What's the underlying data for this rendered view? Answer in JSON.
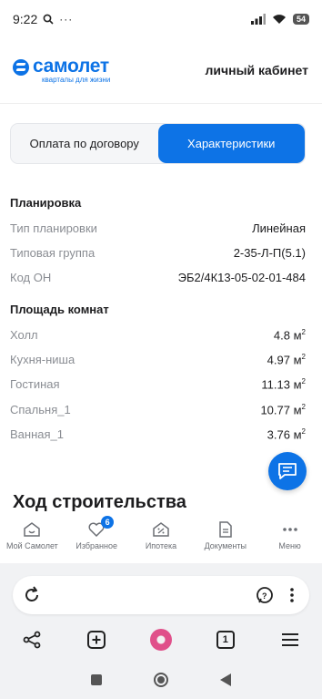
{
  "status_bar": {
    "time": "9:22",
    "battery": "54"
  },
  "header": {
    "logo_name": "самолет",
    "logo_tagline": "кварталы для жизни",
    "cabinet_link": "личный кабинет"
  },
  "tabs": [
    {
      "label": "Оплата по договору",
      "active": false
    },
    {
      "label": "Характеристики",
      "active": true
    }
  ],
  "layout_section": {
    "title": "Планировка",
    "rows": [
      {
        "label": "Тип планировки",
        "value": "Линейная"
      },
      {
        "label": "Типовая группа",
        "value": "2-35-Л-П(5.1)"
      },
      {
        "label": "Код ОН",
        "value": "ЭБ2/4К13-05-02-01-484"
      }
    ]
  },
  "area_section": {
    "title": "Площадь комнат",
    "unit": "м",
    "unit_sup": "2",
    "rows": [
      {
        "label": "Холл",
        "value": "4.8"
      },
      {
        "label": "Кухня-ниша",
        "value": "4.97"
      },
      {
        "label": "Гостиная",
        "value": "11.13"
      },
      {
        "label": "Спальня_1",
        "value": "10.77"
      },
      {
        "label": "Ванная_1",
        "value": "3.76"
      }
    ]
  },
  "construction_heading": "Ход строительства",
  "app_nav": [
    {
      "label": "Мой Самолет",
      "icon": "home-icon"
    },
    {
      "label": "Избранное",
      "icon": "heart-icon",
      "badge": "6"
    },
    {
      "label": "Ипотека",
      "icon": "percent-house-icon"
    },
    {
      "label": "Документы",
      "icon": "document-icon"
    },
    {
      "label": "Меню",
      "icon": "more-dots-icon"
    }
  ],
  "browser": {
    "tab_count": "1"
  },
  "colors": {
    "accent": "#0d73e6",
    "text": "#1d1d1f",
    "muted": "#8a8d93"
  }
}
